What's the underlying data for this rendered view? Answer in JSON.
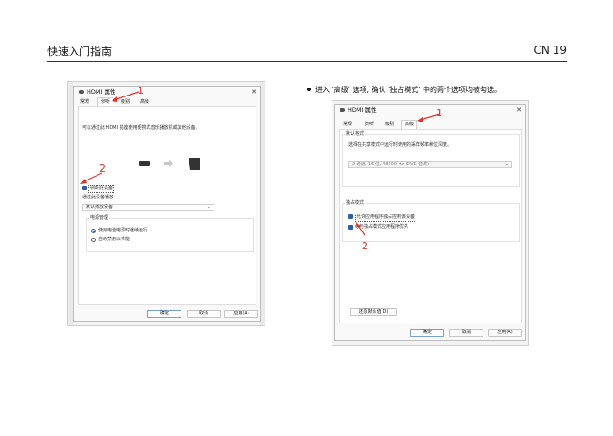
{
  "header": {
    "title": "快速入门指南",
    "page": "CN 19"
  },
  "bullet": {
    "text": "进入 '高级' 选项, 确认 '独占模式' 中的两个选项均被勾选。"
  },
  "left_dialog": {
    "title": "HDMI 属性",
    "tabs": [
      "常规",
      "侦听",
      "级别",
      "高级"
    ],
    "description": "可以通过此 HDMI 插座使用便携式音乐播放机或其他设备。",
    "listen_checkbox": "侦听此设备",
    "playback_label": "通过此设备播放",
    "playback_select": "默认播放设备",
    "power_group": "电源管理",
    "radio1": "使用电池电源时继续运行",
    "radio2": "自动禁用以节能",
    "buttons": {
      "ok": "确定",
      "cancel": "取消",
      "apply": "应用(A)"
    }
  },
  "right_dialog": {
    "title": "HDMI 属性",
    "tabs": [
      "常规",
      "侦听",
      "级别",
      "高级"
    ],
    "default_format_group": "默认格式",
    "default_format_desc": "选择在共享模式中运行时使用的采样频率和位深度。",
    "format_select": "2 通道, 16 位, 48000 Hz (DVD 音质)",
    "exclusive_group": "独占模式",
    "exclusive_opt1": "允许应用程序独占控制该设备",
    "exclusive_opt2": "给与独占模式应用程序优先",
    "restore_button": "还原默认值(D)",
    "buttons": {
      "ok": "确定",
      "cancel": "取消",
      "apply": "应用(A)"
    }
  },
  "annotations": {
    "mark1": "1",
    "mark2": "2"
  },
  "colors": {
    "annotation": "#e0332d",
    "checkbox": "#2b5fa8"
  }
}
